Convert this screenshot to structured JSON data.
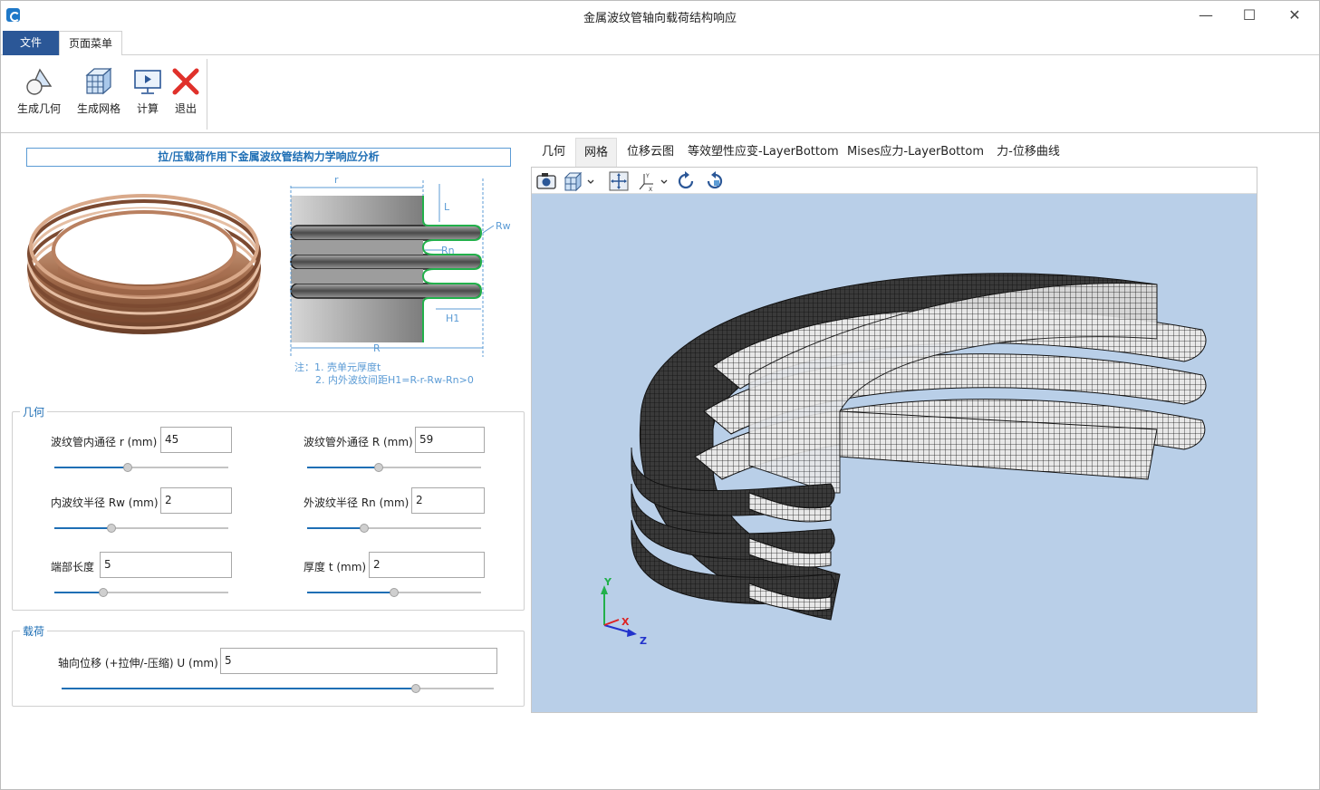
{
  "window": {
    "title": "金属波纹管轴向载荷结构响应",
    "min_glyph": "—",
    "max_glyph": "☐",
    "close_glyph": "✕"
  },
  "menu": {
    "file": "文件",
    "page": "页面菜单"
  },
  "ribbon": {
    "generate_geometry": "生成几何",
    "generate_mesh": "生成网格",
    "compute": "计算",
    "exit": "退出"
  },
  "panel": {
    "headline": "拉/压载荷作用下金属波纹管结构力学响应分析",
    "diagram": {
      "labels": {
        "r": "r",
        "L": "L",
        "Rw": "Rw",
        "Rn": "Rn",
        "H1": "H1",
        "R": "R"
      },
      "note_line1": "注：1. 壳单元厚度t",
      "note_line2": "2. 内外波纹间距H1=R-r-Rw-Rn>0"
    }
  },
  "geometry": {
    "title": "几何",
    "fields": [
      {
        "label": "波纹管内通径 r (mm)",
        "value": "45",
        "slider": 0.42
      },
      {
        "label": "波纹管外通径 R (mm)",
        "value": "59",
        "slider": 0.41
      },
      {
        "label": "内波纹半径 Rw (mm)",
        "value": "2",
        "slider": 0.33
      },
      {
        "label": "外波纹半径 Rn (mm)",
        "value": "2",
        "slider": 0.33
      },
      {
        "label": "端部长度",
        "value": "5",
        "slider": 0.28
      },
      {
        "label": "厚度 t (mm)",
        "value": "2",
        "slider": 0.5
      }
    ]
  },
  "load": {
    "title": "载荷",
    "field": {
      "label": "轴向位移 (+拉伸/-压缩) U (mm)",
      "value": "5",
      "slider": 0.82
    }
  },
  "viewer": {
    "tabs": [
      "几何",
      "网格",
      "位移云图",
      "等效塑性应变-LayerBottom",
      "Mises应力-LayerBottom",
      "力-位移曲线"
    ],
    "active_tab": 1,
    "axes": {
      "y": "Y",
      "x": "X",
      "z": "Z"
    },
    "colors": {
      "background": "#b9cfe8",
      "mesh_light": "#e9e9e9",
      "mesh_dark": "#2a2a2a"
    }
  },
  "colors": {
    "accent": "#1f6fb5",
    "menu_file_bg": "#2b5797"
  }
}
